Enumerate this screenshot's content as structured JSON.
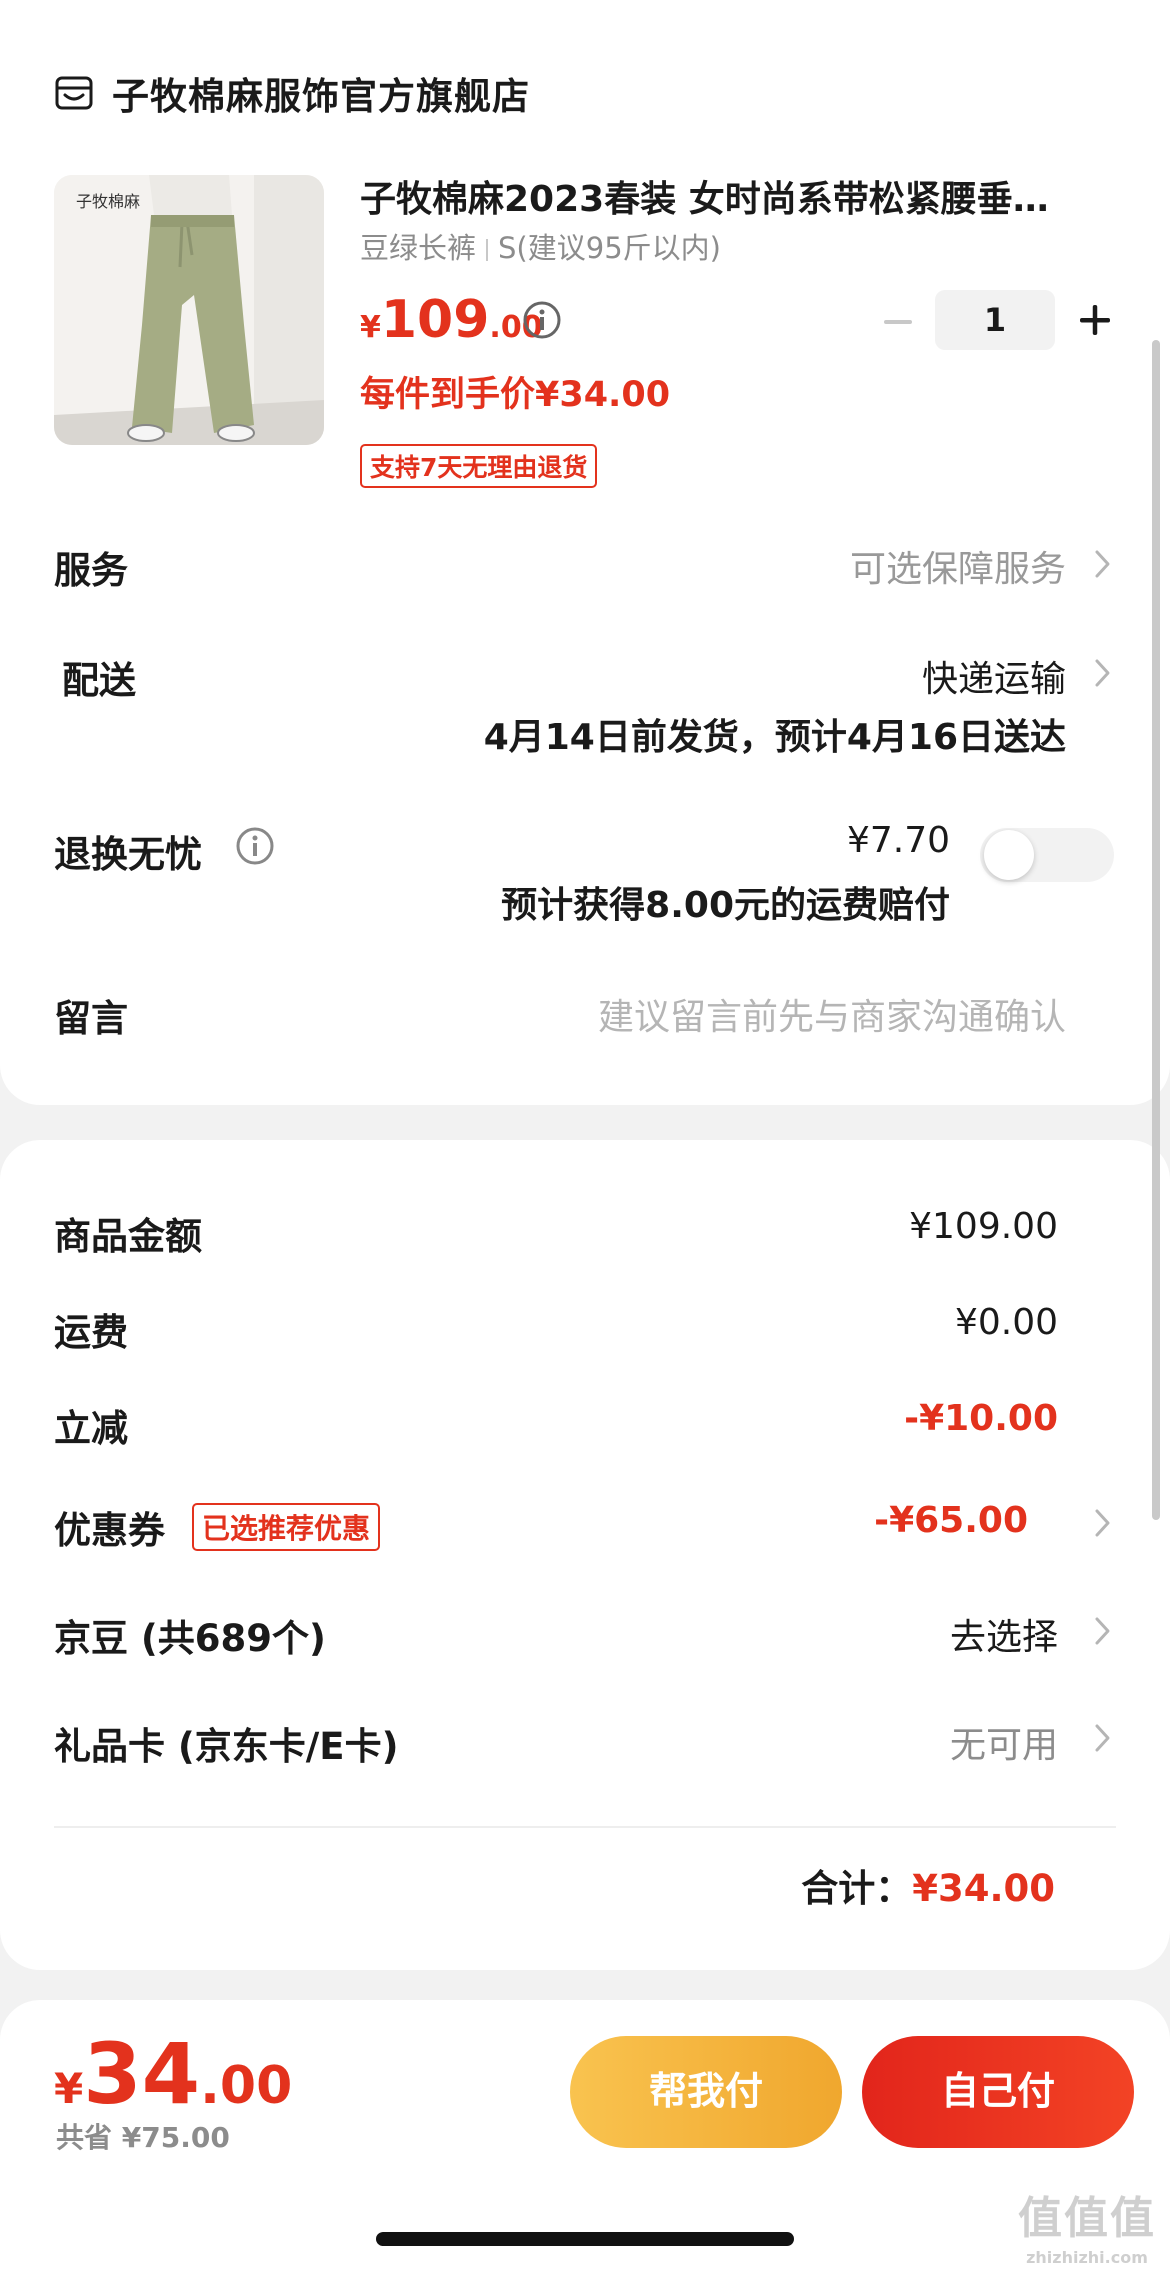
{
  "shop": {
    "name": "子牧棉麻服饰官方旗舰店",
    "icon": "shop-icon"
  },
  "product": {
    "title": "子牧棉麻2023春装 女时尚系带松紧腰垂…",
    "color": "豆绿长裤",
    "size": "S(建议95斤以内)",
    "price_currency": "¥",
    "price_int": "109",
    "price_dec": ".00",
    "quantity": "1",
    "each_price": "每件到手价¥34.00",
    "return_tag": "支持7天无理由退货",
    "thumb_brand": "子牧棉麻"
  },
  "service": {
    "label": "服务",
    "value": "可选保障服务"
  },
  "delivery": {
    "label": "配送",
    "value": "快递运输",
    "eta": "4月14日前发货，预计4月16日送达"
  },
  "return_ins": {
    "label": "退换无忧",
    "price": "¥7.70",
    "note": "预计获得8.00元的运费赔付",
    "enabled": false
  },
  "message": {
    "label": "留言",
    "placeholder": "建议留言前先与商家沟通确认"
  },
  "summary": {
    "goods_label": "商品金额",
    "goods_value": "¥109.00",
    "shipping_label": "运费",
    "shipping_value": "¥0.00",
    "discount_label": "立减",
    "discount_value": "-¥10.00",
    "coupon_label": "优惠券",
    "coupon_tag": "已选推荐优惠",
    "coupon_value": "-¥65.00",
    "beans_label": "京豆 (共689个)",
    "beans_value": "去选择",
    "giftcard_label": "礼品卡 (京东卡/E卡)",
    "giftcard_value": "无可用",
    "total_label": "合计：",
    "total_value": "¥34.00"
  },
  "bottom": {
    "currency": "¥",
    "int": "34",
    "dec": ".00",
    "saved": "共省 ¥75.00",
    "help_pay": "帮我付",
    "self_pay": "自己付"
  },
  "watermark": {
    "line1": "值值值",
    "line2": "zhizhizhi.com"
  },
  "colors": {
    "accent_red": "#e3321d",
    "help_yellow": "#f5b63a"
  }
}
